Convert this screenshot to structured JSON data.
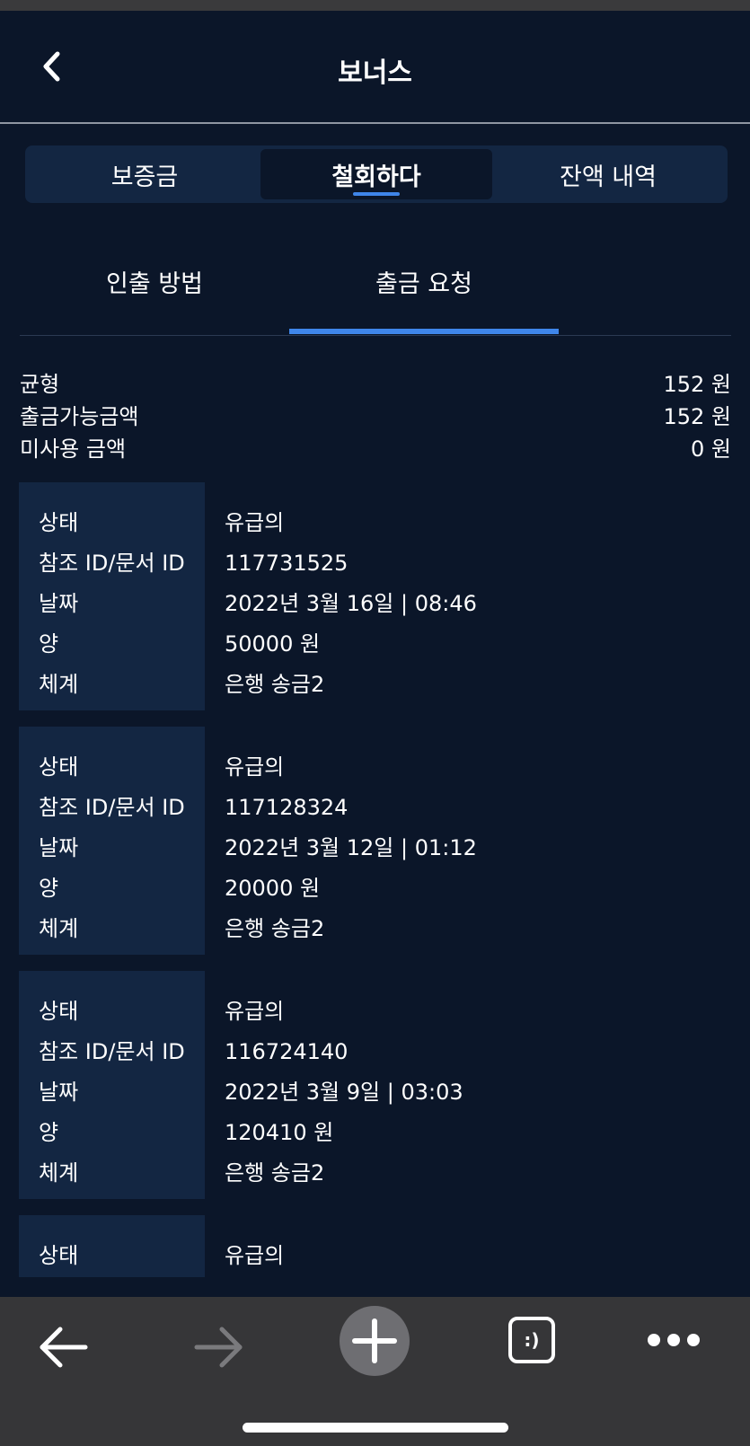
{
  "header": {
    "title": "보너스"
  },
  "seg_tabs": [
    "보증금",
    "철회하다",
    "잔액 내역"
  ],
  "sub_tabs": [
    "인출 방법",
    "출금 요청"
  ],
  "balances": [
    {
      "label": "균형",
      "value": "152 원"
    },
    {
      "label": "출금가능금액",
      "value": "152 원"
    },
    {
      "label": "미사용 금액",
      "value": "0 원"
    }
  ],
  "field_labels": {
    "status": "상태",
    "reference": "참조 ID/문서 ID",
    "date": "날짜",
    "amount": "양",
    "method": "체계"
  },
  "requests": [
    {
      "status": "유급의",
      "reference": "117731525",
      "date": "2022년 3월 16일 | 08:46",
      "amount": "50000 원",
      "method": "은행 송금2"
    },
    {
      "status": "유급의",
      "reference": "117128324",
      "date": "2022년 3월 12일 | 01:12",
      "amount": "20000 원",
      "method": "은행 송금2"
    },
    {
      "status": "유급의",
      "reference": "116724140",
      "date": "2022년 3월 9일 | 03:03",
      "amount": "120410 원",
      "method": "은행 송금2"
    },
    {
      "status": "유급의"
    }
  ],
  "browser_bar": {
    "icons": [
      "back-arrow-icon",
      "forward-arrow-icon",
      "plus-icon",
      "tabs-icon",
      "more-icon"
    ],
    "tabs_icon_text": ":)"
  },
  "colors": {
    "background": "#0b1629",
    "panel": "#132642",
    "accent": "#3f86ea",
    "browser_bar": "#363638"
  }
}
